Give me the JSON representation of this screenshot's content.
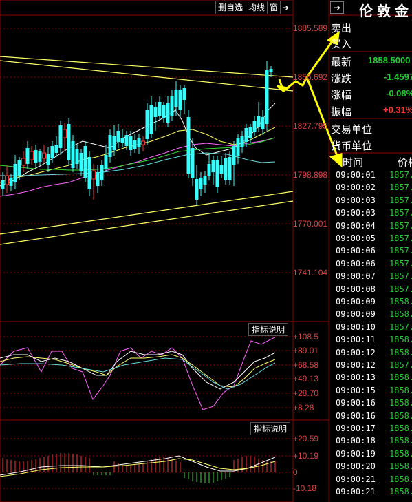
{
  "toolbar": {
    "buttons": [
      "删自选",
      "均线",
      "窗"
    ],
    "icon": "arrow-right-icon"
  },
  "right_panel": {
    "title": "伦敦金",
    "labels": {
      "sell": "卖出",
      "buy": "买入",
      "latest": "最新",
      "change": "涨跌",
      "change_pct": "涨幅",
      "amplitude": "振幅",
      "trade_unit": "交易单位",
      "currency_unit": "货币单位",
      "time_header": "时间",
      "price_header": "价格"
    },
    "values": {
      "latest": "1858.5000",
      "change": "-1.4597",
      "change_pct": "-0.08%",
      "amplitude": "+0.31%"
    },
    "ticks": [
      {
        "time": "09:00:01",
        "price": "1857."
      },
      {
        "time": "09:00:02",
        "price": "1857."
      },
      {
        "time": "09:00:03",
        "price": "1857."
      },
      {
        "time": "09:00:03",
        "price": "1857."
      },
      {
        "time": "09:00:04",
        "price": "1857."
      },
      {
        "time": "09:00:05",
        "price": "1857."
      },
      {
        "time": "09:00:06",
        "price": "1857."
      },
      {
        "time": "09:00:06",
        "price": "1857."
      },
      {
        "time": "09:00:07",
        "price": "1857."
      },
      {
        "time": "09:00:08",
        "price": "1857."
      },
      {
        "time": "09:00:09",
        "price": "1858."
      },
      {
        "time": "09:00:09",
        "price": "1858."
      },
      {
        "time": "09:00:10",
        "price": "1857."
      },
      {
        "time": "09:00:11",
        "price": "1858."
      },
      {
        "time": "09:00:12",
        "price": "1858."
      },
      {
        "time": "09:00:12",
        "price": "1857."
      },
      {
        "time": "09:00:13",
        "price": "1858."
      },
      {
        "time": "09:00:15",
        "price": "1858."
      },
      {
        "time": "09:00:16",
        "price": "1858."
      },
      {
        "time": "09:00:16",
        "price": "1858."
      },
      {
        "time": "09:00:17",
        "price": "1858."
      },
      {
        "time": "09:00:18",
        "price": "1858."
      },
      {
        "time": "09:00:19",
        "price": "1858."
      },
      {
        "time": "09:00:20",
        "price": "1858."
      },
      {
        "time": "09:00:21",
        "price": "1858."
      },
      {
        "time": "09:00:21",
        "price": "1858."
      }
    ]
  },
  "main_axis": {
    "labels": [
      "1885.589",
      "1856.692",
      "1827.795",
      "1798.898",
      "1770.001",
      "1741.104"
    ]
  },
  "indicator1": {
    "button": "指标说明",
    "labels": [
      "+108.5",
      "+89.01",
      "+68.58",
      "+49.13",
      "+28.70",
      "+8.28"
    ]
  },
  "indicator2": {
    "button": "指标说明",
    "labels": [
      "+20.59",
      "+10.19",
      "0",
      "-10.18"
    ]
  },
  "colors": {
    "up": "#ff3333",
    "down": "#33ffff",
    "ma_white": "#ffffff",
    "ma_yellow": "#ffff66",
    "ma_magenta": "#ff66ff",
    "ma_green": "#33dd33",
    "price_green": "#22cc33",
    "price_red": "#ff3333",
    "arrow": "#ffff00"
  }
}
